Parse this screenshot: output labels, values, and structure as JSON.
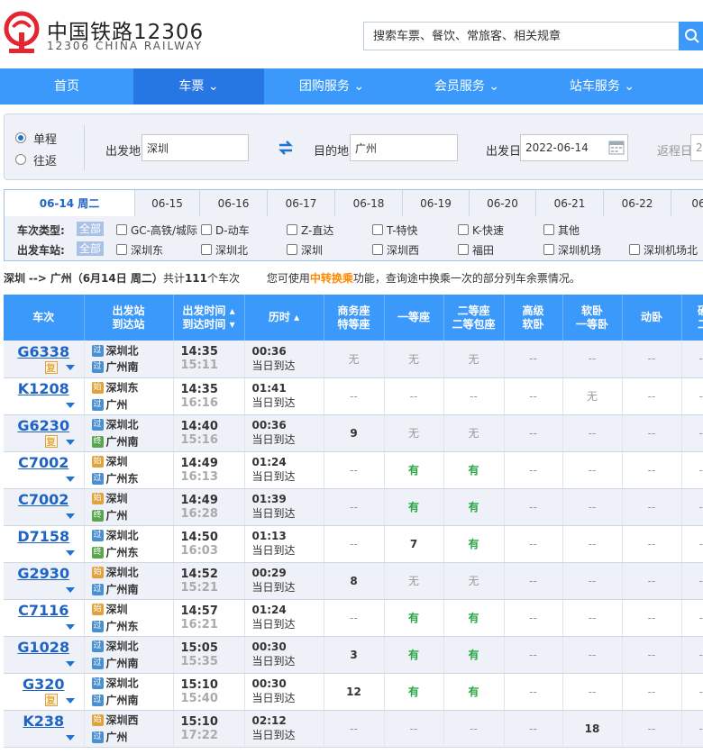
{
  "header": {
    "logo_cn": "中国铁路12306",
    "logo_en": "12306 CHINA RAILWAY",
    "search_placeholder": "搜索车票、餐饮、常旅客、相关规章",
    "brand_color": "#3b99fc"
  },
  "nav": [
    {
      "label": "首页"
    },
    {
      "label": "车票"
    },
    {
      "label": "团购服务"
    },
    {
      "label": "会员服务"
    },
    {
      "label": "站车服务"
    }
  ],
  "query": {
    "one_way": "单程",
    "round_trip": "往返",
    "from_label": "出发地",
    "from_value": "深圳",
    "to_label": "目的地",
    "to_value": "广州",
    "depart_label": "出发日",
    "depart_value": "2022-06-14",
    "return_label": "返程日",
    "return_value": "2"
  },
  "date_tabs": [
    "06-14 周二",
    "06-15",
    "06-16",
    "06-17",
    "06-18",
    "06-19",
    "06-20",
    "06-21",
    "06-22",
    "06"
  ],
  "filters": {
    "type_label": "车次类型:",
    "station_label": "出发车站:",
    "all": "全部",
    "types": [
      "GC-高铁/城际",
      "D-动车",
      "Z-直达",
      "T-特快",
      "K-快速",
      "其他"
    ],
    "stations": [
      "深圳东",
      "深圳北",
      "深圳",
      "深圳西",
      "福田",
      "深圳机场",
      "深圳机场北"
    ]
  },
  "summary": {
    "from": "深圳",
    "arrow": "-->",
    "to": "广州",
    "date": "（6月14日  周二）",
    "total_pre": "共计",
    "total": "111",
    "total_post": "个车次",
    "hint_pre": "您可使用",
    "hint_link": "中转换乘",
    "hint_post": "功能，查询途中换乘一次的部分列车余票情况。"
  },
  "table": {
    "headers": [
      {
        "l1": "车次",
        "l2": ""
      },
      {
        "l1": "出发站",
        "l2": "到达站"
      },
      {
        "l1": "出发时间 ▴",
        "l2": "到达时间 ▾"
      },
      {
        "l1": "历时 ▴",
        "l2": ""
      },
      {
        "l1": "商务座",
        "l2": "特等座"
      },
      {
        "l1": "一等座",
        "l2": ""
      },
      {
        "l1": "二等座",
        "l2": "二等包座"
      },
      {
        "l1": "高级",
        "l2": "软卧"
      },
      {
        "l1": "软卧",
        "l2": "一等卧"
      },
      {
        "l1": "动卧",
        "l2": ""
      },
      {
        "l1": "硬",
        "l2": "二"
      }
    ],
    "same_day": "当日到达",
    "fu_label": "复",
    "rows": [
      {
        "no": "G6338",
        "fu": true,
        "from": "深圳北",
        "from_badge": "过",
        "to": "广州南",
        "to_badge": "过",
        "dep": "14:35",
        "arr": "15:11",
        "dur": "00:36",
        "seats": [
          "无",
          "无",
          "无",
          "--",
          "--",
          "--",
          "--"
        ]
      },
      {
        "no": "K1208",
        "fu": false,
        "from": "深圳东",
        "from_badge": "始",
        "to": "广州",
        "to_badge": "过",
        "dep": "14:35",
        "arr": "16:16",
        "dur": "01:41",
        "seats": [
          "--",
          "--",
          "--",
          "--",
          "无",
          "--",
          "--"
        ]
      },
      {
        "no": "G6230",
        "fu": true,
        "from": "深圳北",
        "from_badge": "过",
        "to": "广州南",
        "to_badge": "终",
        "dep": "14:40",
        "arr": "15:16",
        "dur": "00:36",
        "seats": [
          "9",
          "无",
          "无",
          "--",
          "--",
          "--",
          "--"
        ]
      },
      {
        "no": "C7002",
        "fu": false,
        "from": "深圳",
        "from_badge": "始",
        "to": "广州东",
        "to_badge": "过",
        "dep": "14:49",
        "arr": "16:13",
        "dur": "01:24",
        "seats": [
          "--",
          "有",
          "有",
          "--",
          "--",
          "--",
          "--"
        ]
      },
      {
        "no": "C7002",
        "fu": false,
        "from": "深圳",
        "from_badge": "始",
        "to": "广州",
        "to_badge": "终",
        "dep": "14:49",
        "arr": "16:28",
        "dur": "01:39",
        "seats": [
          "--",
          "有",
          "有",
          "--",
          "--",
          "--",
          "--"
        ]
      },
      {
        "no": "D7158",
        "fu": false,
        "from": "深圳北",
        "from_badge": "过",
        "to": "广州东",
        "to_badge": "终",
        "dep": "14:50",
        "arr": "16:03",
        "dur": "01:13",
        "seats": [
          "--",
          "7",
          "有",
          "--",
          "--",
          "--",
          "--"
        ]
      },
      {
        "no": "G2930",
        "fu": false,
        "from": "深圳北",
        "from_badge": "始",
        "to": "广州南",
        "to_badge": "过",
        "dep": "14:52",
        "arr": "15:21",
        "dur": "00:29",
        "seats": [
          "8",
          "无",
          "无",
          "--",
          "--",
          "--",
          "--"
        ]
      },
      {
        "no": "C7116",
        "fu": false,
        "from": "深圳",
        "from_badge": "始",
        "to": "广州东",
        "to_badge": "过",
        "dep": "14:57",
        "arr": "16:21",
        "dur": "01:24",
        "seats": [
          "--",
          "有",
          "有",
          "--",
          "--",
          "--",
          "--"
        ]
      },
      {
        "no": "G1028",
        "fu": false,
        "from": "深圳北",
        "from_badge": "过",
        "to": "广州南",
        "to_badge": "过",
        "dep": "15:05",
        "arr": "15:35",
        "dur": "00:30",
        "seats": [
          "3",
          "有",
          "有",
          "--",
          "--",
          "--",
          "--"
        ]
      },
      {
        "no": "G320",
        "fu": true,
        "from": "深圳北",
        "from_badge": "过",
        "to": "广州南",
        "to_badge": "过",
        "dep": "15:10",
        "arr": "15:40",
        "dur": "00:30",
        "seats": [
          "12",
          "有",
          "有",
          "--",
          "--",
          "--",
          "--"
        ]
      },
      {
        "no": "K238",
        "fu": false,
        "from": "深圳西",
        "from_badge": "始",
        "to": "广州",
        "to_badge": "过",
        "dep": "15:10",
        "arr": "17:22",
        "dur": "02:12",
        "seats": [
          "--",
          "--",
          "--",
          "--",
          "18",
          "--",
          "--"
        ]
      }
    ]
  }
}
